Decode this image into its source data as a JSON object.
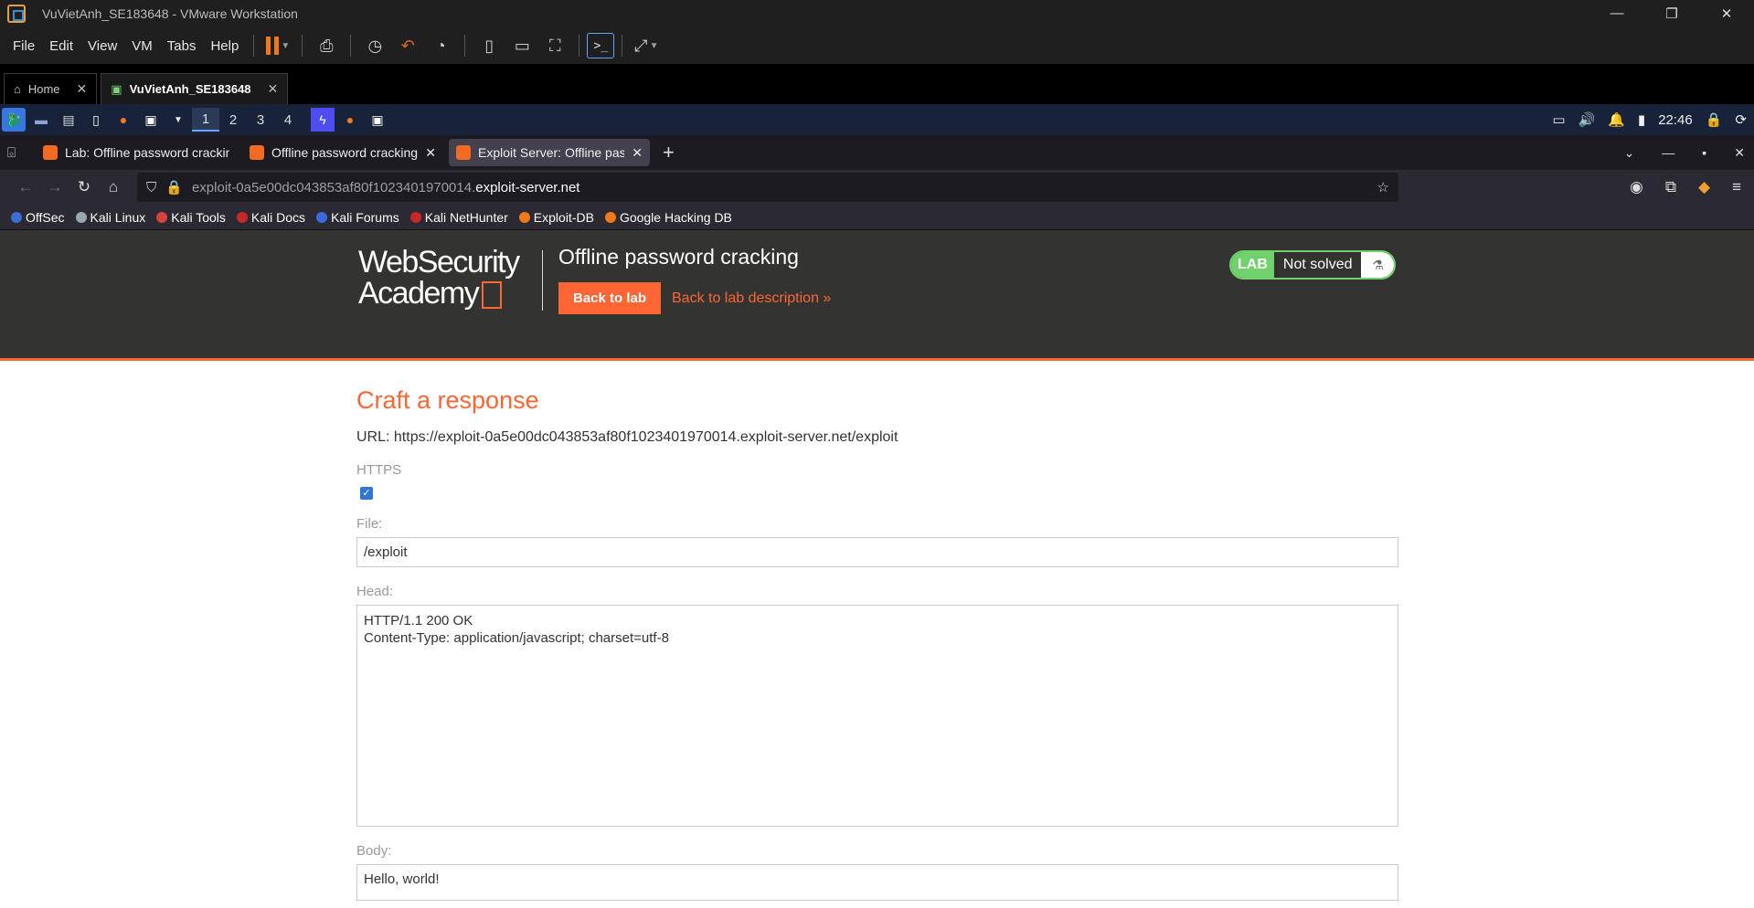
{
  "vmware": {
    "window_title": "VuVietAnh_SE183648 - VMware Workstation",
    "menu": [
      "File",
      "Edit",
      "View",
      "VM",
      "Tabs",
      "Help"
    ],
    "tabs": [
      {
        "label": "Home",
        "active": false
      },
      {
        "label": "VuVietAnh_SE183648",
        "active": true
      }
    ]
  },
  "kali_panel": {
    "workspaces": [
      "1",
      "2",
      "3",
      "4"
    ],
    "active_workspace": "1",
    "clock": "22:46"
  },
  "browser": {
    "tabs": [
      {
        "label": "Lab: Offline password cracking",
        "active": false
      },
      {
        "label": "Offline password cracking",
        "active": false
      },
      {
        "label": "Exploit Server: Offline password cracking",
        "active": true
      }
    ],
    "url_prefix": "exploit-0a5e00dc043853af80f1023401970014.",
    "url_domain": "exploit-server.net",
    "bookmarks": [
      {
        "label": "OffSec",
        "color": "#3d6bd8"
      },
      {
        "label": "Kali Linux",
        "color": "#9aa6b2"
      },
      {
        "label": "Kali Tools",
        "color": "#d8423d"
      },
      {
        "label": "Kali Docs",
        "color": "#c62828"
      },
      {
        "label": "Kali Forums",
        "color": "#3d6bd8"
      },
      {
        "label": "Kali NetHunter",
        "color": "#c62828"
      },
      {
        "label": "Exploit-DB",
        "color": "#f07a1a"
      },
      {
        "label": "Google Hacking DB",
        "color": "#f07a1a"
      }
    ]
  },
  "lab": {
    "logo_line1": "WebSecurity",
    "logo_line2": "Academy",
    "title": "Offline password cracking",
    "back_to_lab": "Back to lab",
    "back_to_description": "Back to lab description »",
    "badge": "LAB",
    "status": "Not solved",
    "accent": "#ff6633",
    "status_color": "#70d16d"
  },
  "form": {
    "heading": "Craft a response",
    "url_line": "URL: https://exploit-0a5e00dc043853af80f1023401970014.exploit-server.net/exploit",
    "https_label": "HTTPS",
    "https_checked": true,
    "file_label": "File:",
    "file_value": "/exploit",
    "head_label": "Head:",
    "head_value": "HTTP/1.1 200 OK\nContent-Type: application/javascript; charset=utf-8",
    "body_label": "Body:",
    "body_value": "Hello, world!"
  }
}
